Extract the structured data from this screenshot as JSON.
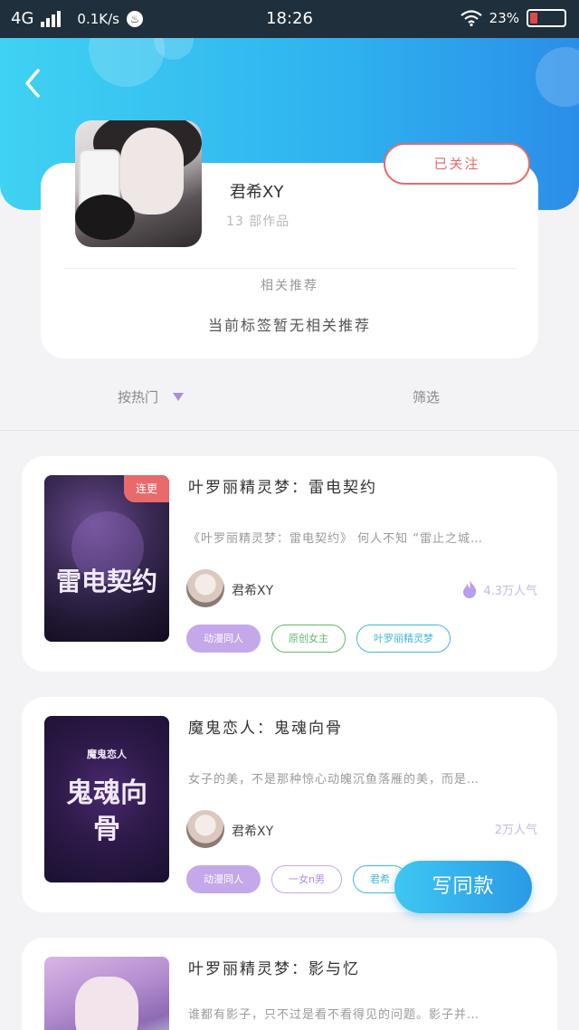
{
  "status_bar": {
    "network": "4G",
    "speed": "0.1K/s",
    "time": "18:26",
    "battery": "23%",
    "battery_level": 0.23
  },
  "profile": {
    "author_name": "君希XY",
    "works_count": "13 部作品",
    "follow_label": "已关注",
    "recommend_title": "相关推荐",
    "recommend_empty": "当前标签暂无相关推荐"
  },
  "filters": {
    "sort_label": "按热门",
    "filter_label": "筛选"
  },
  "books": [
    {
      "title": "叶罗丽精灵梦：雷电契约",
      "cover_text": "雷电契约",
      "badge": "连更",
      "description": "《叶罗丽精灵梦：雷电契约》 何人不知 “雷止之城…",
      "author": "君希XY",
      "popularity": "4.3万人气",
      "tags": [
        "动漫同人",
        "原创女主",
        "叶罗丽精灵梦"
      ]
    },
    {
      "title": "魔鬼恋人：鬼魂向骨",
      "cover_text": "鬼魂向骨",
      "cover_sub": "魔鬼恋人",
      "description": "女子的美，不是那种惊心动魄沉鱼落雁的美，而是…",
      "author": "君希XY",
      "popularity": "2万人气",
      "tags": [
        "动漫同人",
        "一女n男",
        "君希"
      ]
    },
    {
      "title": "叶罗丽精灵梦：影与忆",
      "description": "谁都有影子，只不过是看不看得见的问题。影子并…"
    }
  ],
  "fab": {
    "label": "写同款"
  },
  "colors": {
    "header_gradient_start": "#3fd2f2",
    "header_gradient_end": "#2a8ee8",
    "follow": "#e56b6b",
    "badge": "#e86a6a",
    "tag_purple": "#c5a8ea",
    "tag_green": "#62b66e",
    "tag_teal": "#46b6d6",
    "popularity": "#c6b8e8"
  }
}
